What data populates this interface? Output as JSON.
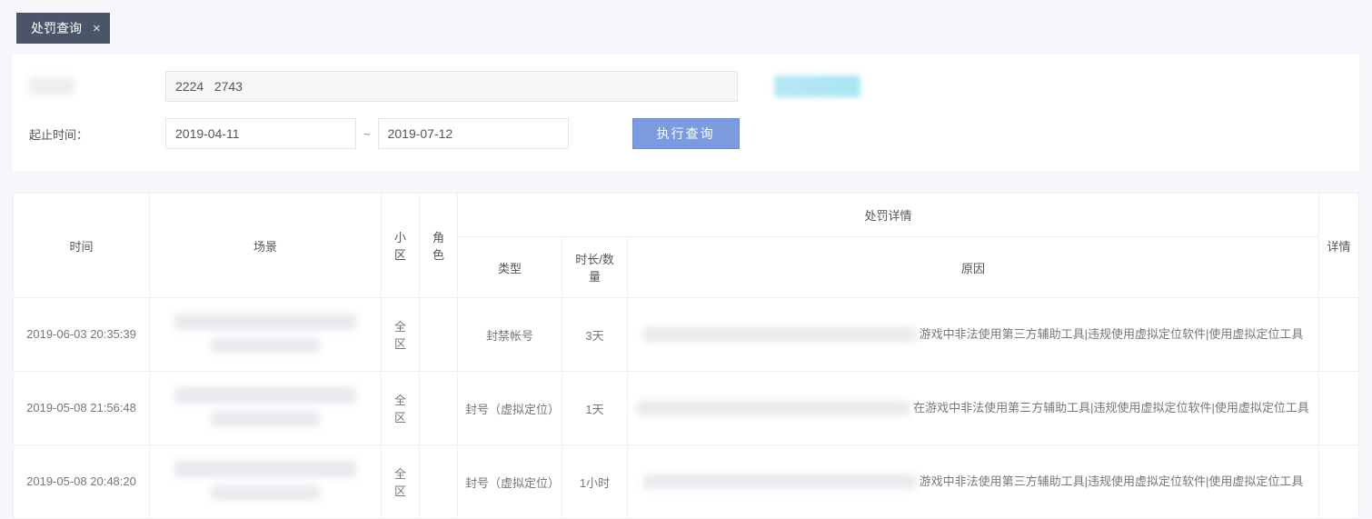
{
  "tab": {
    "title": "处罚查询"
  },
  "filters": {
    "id_value": "2224   2743",
    "date_label": "起止时间：",
    "date_from": "2019-04-11",
    "date_to": "2019-07-12",
    "query_label": "执行查询"
  },
  "table": {
    "headers": {
      "time": "时间",
      "scene": "场景",
      "zone": "小区",
      "role": "角色",
      "penalty_group": "处罚详情",
      "type": "类型",
      "duration": "时长/数量",
      "reason": "原因",
      "detail": "详情"
    },
    "rows": [
      {
        "time": "2019-06-03 20:35:39",
        "zone": "全区",
        "role": "",
        "type": "封禁帐号",
        "duration": "3天",
        "reason_tail": "游戏中非法使用第三方辅助工具|违规使用虚拟定位软件|使用虚拟定位工具"
      },
      {
        "time": "2019-05-08 21:56:48",
        "zone": "全区",
        "role": "",
        "type": "封号（虚拟定位）",
        "duration": "1天",
        "reason_tail": "在游戏中非法使用第三方辅助工具|违规使用虚拟定位软件|使用虚拟定位工具"
      },
      {
        "time": "2019-05-08 20:48:20",
        "zone": "全区",
        "role": "",
        "type": "封号（虚拟定位）",
        "duration": "1小时",
        "reason_tail": "游戏中非法使用第三方辅助工具|违规使用虚拟定位软件|使用虚拟定位工具"
      }
    ]
  }
}
